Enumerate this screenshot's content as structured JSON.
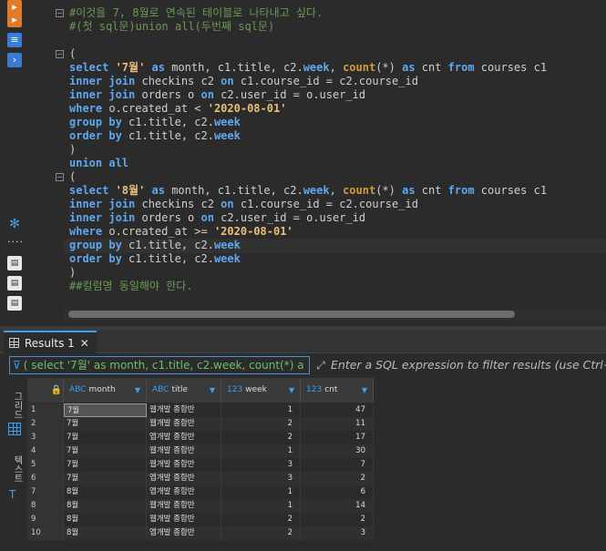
{
  "editor": {
    "lines": [
      {
        "fold": "−",
        "tokens": [
          {
            "t": "#이것을 7, 8월로 연속된 테이블로 나타내고 싶다.",
            "c": "cmt"
          }
        ]
      },
      {
        "tokens": [
          {
            "t": "#(첫 sql문)union all(두번째 sql문)",
            "c": "cmt"
          }
        ]
      },
      {
        "tokens": []
      },
      {
        "fold": "−",
        "tokens": [
          {
            "t": "(",
            "c": ""
          }
        ]
      },
      {
        "tokens": [
          {
            "t": "select ",
            "c": "kw"
          },
          {
            "t": "'7월'",
            "c": "str"
          },
          {
            "t": " as ",
            "c": "kw"
          },
          {
            "t": "month, c1.title, c2.",
            "c": ""
          },
          {
            "t": "week",
            "c": "kw"
          },
          {
            "t": ", ",
            "c": ""
          },
          {
            "t": "count",
            "c": "br"
          },
          {
            "t": "(*) ",
            "c": ""
          },
          {
            "t": "as",
            "c": "kw"
          },
          {
            "t": " cnt ",
            "c": ""
          },
          {
            "t": "from",
            "c": "kw"
          },
          {
            "t": " courses c1",
            "c": ""
          }
        ]
      },
      {
        "tokens": [
          {
            "t": "inner join",
            "c": "kw"
          },
          {
            "t": " checkins c2 ",
            "c": ""
          },
          {
            "t": "on",
            "c": "kw"
          },
          {
            "t": " c1.course_id = c2.course_id",
            "c": ""
          }
        ]
      },
      {
        "tokens": [
          {
            "t": "inner join",
            "c": "kw"
          },
          {
            "t": " orders o ",
            "c": ""
          },
          {
            "t": "on",
            "c": "kw"
          },
          {
            "t": " c2.user_id = o.user_id",
            "c": ""
          }
        ]
      },
      {
        "tokens": [
          {
            "t": "where",
            "c": "kw"
          },
          {
            "t": " o.created_at < ",
            "c": ""
          },
          {
            "t": "'2020-08-01'",
            "c": "str"
          }
        ]
      },
      {
        "tokens": [
          {
            "t": "group by",
            "c": "kw"
          },
          {
            "t": " c1.title, c2.",
            "c": ""
          },
          {
            "t": "week",
            "c": "kw"
          }
        ]
      },
      {
        "tokens": [
          {
            "t": "order by",
            "c": "kw"
          },
          {
            "t": " c1.title, c2.",
            "c": ""
          },
          {
            "t": "week",
            "c": "kw"
          }
        ]
      },
      {
        "tokens": [
          {
            "t": ")",
            "c": ""
          }
        ]
      },
      {
        "tokens": [
          {
            "t": "union all",
            "c": "kw"
          }
        ]
      },
      {
        "fold": "−",
        "tokens": [
          {
            "t": "(",
            "c": ""
          }
        ]
      },
      {
        "tokens": [
          {
            "t": "select ",
            "c": "kw"
          },
          {
            "t": "'8월'",
            "c": "str"
          },
          {
            "t": " as ",
            "c": "kw"
          },
          {
            "t": "month, c1.title, c2.",
            "c": ""
          },
          {
            "t": "week",
            "c": "kw"
          },
          {
            "t": ", ",
            "c": ""
          },
          {
            "t": "count",
            "c": "br"
          },
          {
            "t": "(*) ",
            "c": ""
          },
          {
            "t": "as",
            "c": "kw"
          },
          {
            "t": " cnt ",
            "c": ""
          },
          {
            "t": "from",
            "c": "kw"
          },
          {
            "t": " courses c1",
            "c": ""
          }
        ]
      },
      {
        "tokens": [
          {
            "t": "inner join",
            "c": "kw"
          },
          {
            "t": " checkins c2 ",
            "c": ""
          },
          {
            "t": "on",
            "c": "kw"
          },
          {
            "t": " c1.course_id = c2.course_id",
            "c": ""
          }
        ]
      },
      {
        "tokens": [
          {
            "t": "inner join",
            "c": "kw"
          },
          {
            "t": " orders o ",
            "c": ""
          },
          {
            "t": "on",
            "c": "kw"
          },
          {
            "t": " c2.user_id = o.user_id",
            "c": ""
          }
        ]
      },
      {
        "tokens": [
          {
            "t": "where",
            "c": "kw"
          },
          {
            "t": " o.created_at >= ",
            "c": ""
          },
          {
            "t": "'2020-08-01'",
            "c": "str"
          }
        ]
      },
      {
        "tokens": [
          {
            "t": "group by",
            "c": "kw"
          },
          {
            "t": " c1.title, c2.",
            "c": ""
          },
          {
            "t": "week",
            "c": "kw"
          }
        ]
      },
      {
        "tokens": [
          {
            "t": "order by",
            "c": "kw"
          },
          {
            "t": " c1.title, c2.",
            "c": ""
          },
          {
            "t": "week",
            "c": "kw"
          }
        ]
      },
      {
        "tokens": [
          {
            "t": ")",
            "c": ""
          }
        ]
      },
      {
        "tokens": [
          {
            "t": "##컬럼명 동일해야 한다.",
            "c": "cmt"
          }
        ]
      }
    ]
  },
  "results": {
    "tab_label": "Results 1",
    "close_glyph": "✕",
    "filter_query": "( select '7월' as month, c1.title, c2.week, count(*) a",
    "filter_placeholder": "Enter a SQL expression to filter results (use Ctrl+Space)",
    "side_tabs": {
      "grid": "그리드",
      "text": "텍스트"
    },
    "columns": [
      {
        "type": "ABC",
        "name": "month"
      },
      {
        "type": "ABC",
        "name": "title"
      },
      {
        "type": "123",
        "name": "week"
      },
      {
        "type": "123",
        "name": "cnt"
      }
    ],
    "rows": [
      [
        "1",
        "7월",
        "웹개발 종합반",
        "1",
        "47"
      ],
      [
        "2",
        "7월",
        "웹개발 종합반",
        "2",
        "11"
      ],
      [
        "3",
        "7월",
        "앱개발 종합반",
        "2",
        "17"
      ],
      [
        "4",
        "7월",
        "웹개발 종합반",
        "1",
        "30"
      ],
      [
        "5",
        "7월",
        "웹개발 종합반",
        "3",
        "7"
      ],
      [
        "6",
        "7월",
        "앱개발 종합반",
        "3",
        "2"
      ],
      [
        "7",
        "8월",
        "앱개발 종합반",
        "1",
        "6"
      ],
      [
        "8",
        "8월",
        "웹개발 종합반",
        "1",
        "14"
      ],
      [
        "9",
        "8월",
        "웹개발 종합반",
        "2",
        "2"
      ],
      [
        "10",
        "8월",
        "앱개발 종합반",
        "2",
        "3"
      ]
    ]
  },
  "colors": {
    "accent": "#3ba0f0",
    "keyword": "#5fa8f0",
    "comment": "#6a9955",
    "string": "#e8c07a"
  }
}
